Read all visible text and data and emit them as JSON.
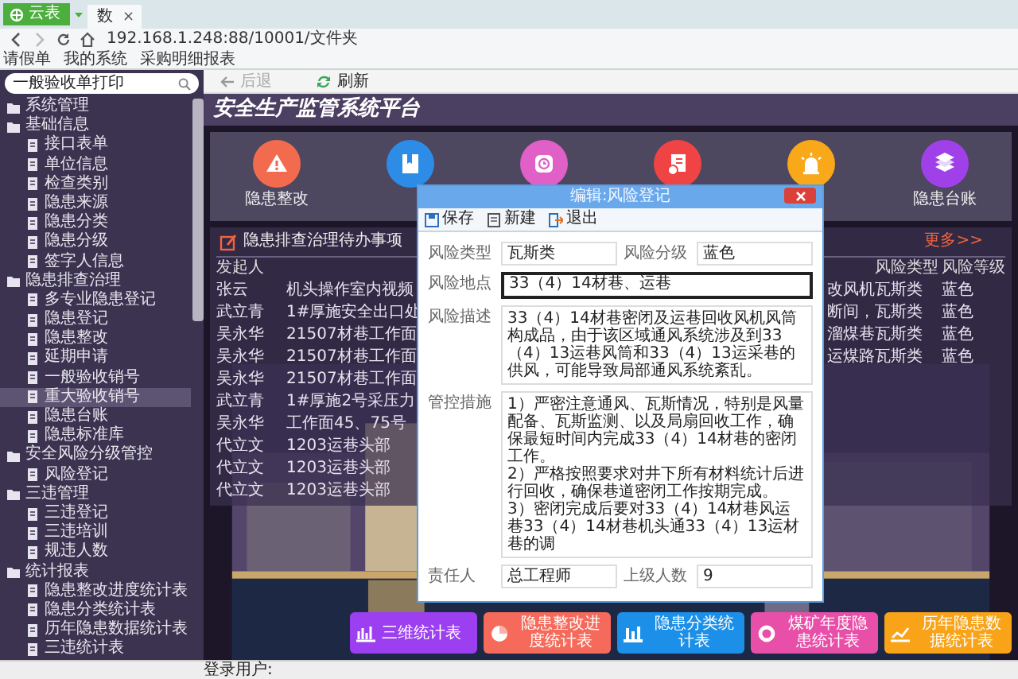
{
  "browser": {
    "app_button": "云表",
    "tabs": [
      {
        "label": "数",
        "close": "×",
        "selected": true
      }
    ],
    "address": "192.168.1.248:88/10001/文件夹",
    "bookmarks": [
      "请假单",
      "我的系统",
      "采购明细报表"
    ]
  },
  "sidebar": {
    "search": {
      "value": "一般验收单打印"
    },
    "items": [
      {
        "label": "系统管理",
        "selected": false
      },
      {
        "label": "基础信息",
        "selected": false,
        "expanded": true,
        "children": [
          {
            "label": "接口表单",
            "selected": false
          },
          {
            "label": "单位信息",
            "selected": false
          },
          {
            "label": "检查类别",
            "selected": false
          },
          {
            "label": "隐患来源",
            "selected": false
          },
          {
            "label": "隐患分类",
            "selected": false
          },
          {
            "label": "隐患分级",
            "selected": false
          },
          {
            "label": "签字人信息",
            "selected": false
          }
        ]
      },
      {
        "label": "隐患排查治理",
        "selected": false,
        "expanded": true,
        "children": [
          {
            "label": "多专业隐患登记",
            "selected": false
          },
          {
            "label": "隐患登记",
            "selected": false
          },
          {
            "label": "隐患整改",
            "selected": false
          },
          {
            "label": "延期申请",
            "selected": false
          },
          {
            "label": "一般验收销号",
            "selected": false
          },
          {
            "label": "重大验收销号",
            "selected": true
          },
          {
            "label": "隐患台账",
            "selected": false
          },
          {
            "label": "隐患标准库",
            "selected": false
          }
        ]
      },
      {
        "label": "安全风险分级管控",
        "selected": false,
        "expanded": true,
        "children": [
          {
            "label": "风险登记",
            "selected": false
          }
        ]
      },
      {
        "label": "三违管理",
        "selected": false,
        "expanded": true,
        "children": [
          {
            "label": "三违登记",
            "selected": false
          },
          {
            "label": "三违培训",
            "selected": false
          },
          {
            "label": "规违人数",
            "selected": false
          }
        ]
      },
      {
        "label": "统计报表",
        "selected": false,
        "expanded": true,
        "children": [
          {
            "label": "隐患整改进度统计表",
            "selected": false
          },
          {
            "label": "隐患分类统计表",
            "selected": false
          },
          {
            "label": "历年隐患数据统计表",
            "selected": false
          },
          {
            "label": "三违统计表",
            "selected": false
          }
        ]
      }
    ]
  },
  "toolbar": [
    {
      "label": "后退",
      "kind": "back",
      "disabled": true
    },
    {
      "label": "刷新",
      "kind": "refresh",
      "disabled": false
    }
  ],
  "app_title": "安全生产监管系统平台",
  "modules": [
    {
      "label": "隐患整改",
      "color": "#f26b4f"
    },
    {
      "color": "#2d8ce6"
    },
    {
      "color": "#e060c8"
    },
    {
      "color": "#f04444"
    },
    {
      "color": "#f8a818"
    },
    {
      "label": "隐患台账",
      "color": "#a040e8"
    }
  ],
  "todo": {
    "title": "隐患排查治理待办事项",
    "more": "更多>>",
    "header": {
      "initiator": "发起人",
      "risk_type": "风险类型",
      "risk_level": "风险等级"
    },
    "rows": [
      {
        "initiator": "张云",
        "description": "机头操作室内视频",
        "column_3": "改风机",
        "risk_type": "瓦斯类",
        "risk_level": "蓝色"
      },
      {
        "initiator": "武立青",
        "description": "1#厚施安全出口处",
        "column_3": "断间，",
        "risk_type": "瓦斯类",
        "risk_level": "蓝色"
      },
      {
        "initiator": "吴永华",
        "description": "21507材巷工作面",
        "column_3": "溜煤巷",
        "risk_type": "瓦斯类",
        "risk_level": "蓝色"
      },
      {
        "initiator": "吴永华",
        "description": "21507材巷工作面",
        "column_3": "运煤路",
        "risk_type": "瓦斯类",
        "risk_level": "蓝色"
      },
      {
        "initiator": "吴永华",
        "description": "21507材巷工作面"
      },
      {
        "initiator": "武立青",
        "description": "1#厚施2号采压力"
      },
      {
        "initiator": "吴永华",
        "description": "工作面45、75号"
      },
      {
        "initiator": "代立文",
        "description": "1203运巷头部"
      },
      {
        "initiator": "代立文",
        "description": "1203运巷头部"
      },
      {
        "initiator": "代立文",
        "description": "1203运巷头部"
      }
    ]
  },
  "reports": [
    {
      "label": "三维统计表",
      "kind": "bars",
      "color": "#9b3ff0"
    },
    {
      "label": "隐患整改进度统计表",
      "kind": "pie",
      "color": "#f56a5a"
    },
    {
      "label": "隐患分类统计表",
      "kind": "columns",
      "color": "#1c8fe8"
    },
    {
      "label": "煤矿年度隐患统计表",
      "kind": "donut",
      "color": "#e84fa8"
    },
    {
      "label": "历年隐患数据统计表",
      "kind": "trend",
      "color": "#f8a318"
    }
  ],
  "dialog": {
    "title": "编辑:风险登记",
    "toolbar": [
      {
        "label": "保存",
        "kind": "save"
      },
      {
        "label": "新建",
        "kind": "new"
      },
      {
        "label": "退出",
        "kind": "exit"
      }
    ],
    "fields": [
      {
        "label": "风险类型",
        "value": "瓦斯类",
        "kind": "short",
        "focused": false
      },
      {
        "label": "风险分级",
        "value": "蓝色",
        "kind": "short",
        "focused": false
      },
      {
        "label": "风险地点",
        "value": "33（4）14材巷、运巷",
        "kind": "wide",
        "focused": true
      },
      {
        "label": "风险描述",
        "value": "33（4）14材巷密闭及运巷回收风机风筒构成品，由于该区域通风系统涉及到33（4）13运巷风筒和33（4）13运采巷的供风，可能导致局部通风系统紊乱。",
        "kind": "area",
        "focused": false
      },
      {
        "label": "管控措施",
        "value": "1）严密注意通风、瓦斯情况，特别是风量配备、瓦斯监测、以及局扇回收工作，确保最短时间内完成33（4）14材巷的密闭工作。\n2）严格按照要求对井下所有材料统计后进行回收，确保巷道密闭工作按期完成。\n3）密闭完成后要对33（4）14材巷风运巷33（4）14材巷机头通33（4）13运材巷的调",
        "kind": "area",
        "focused": false
      },
      {
        "label": "责任人",
        "value": "总工程师",
        "kind": "short",
        "focused": false
      },
      {
        "label": "上级人数",
        "value": "9",
        "kind": "short",
        "focused": false
      }
    ]
  },
  "status_bar": {
    "user_label": "登录用户:"
  }
}
